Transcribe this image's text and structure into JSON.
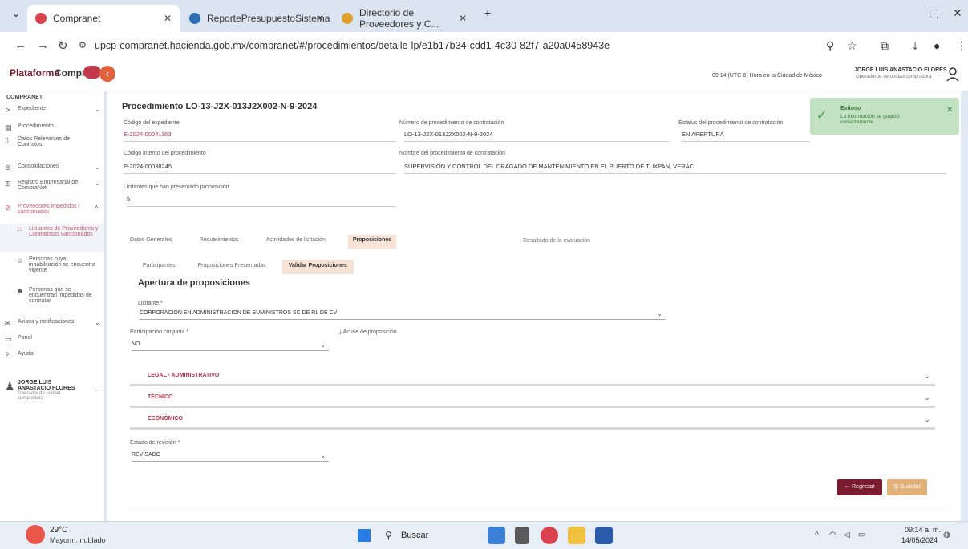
{
  "browser": {
    "tabs": [
      {
        "label": "Compranet"
      },
      {
        "label": "ReportePresupuestoSistema"
      },
      {
        "label": "Directorio de Proveedores y C..."
      }
    ],
    "new_tab": "+",
    "url": "upcp-compranet.hacienda.gob.mx/compranet/#/procedimientos/detalle-lp/e1b17b34-cdd1-4c30-82f7-a20a0458943e"
  },
  "header": {
    "logo_part1": "Plataforma",
    "logo_part2": "Compra",
    "hora": "09:14 (UTC-6) Hora en la Ciudad de México",
    "user_name": "JORGE LUIS ANASTACIO FLORES",
    "user_role": "Operador(a) de unidad compradora"
  },
  "sidebar": {
    "title": "COMPRANET",
    "items": [
      {
        "label": "Expediente",
        "icon": "folder-icon"
      },
      {
        "label": "Procedimiento",
        "icon": "document-icon"
      },
      {
        "label": "Datos Relevantes de Contratos",
        "icon": "bookmark-icon"
      },
      {
        "label": "Consolidaciones",
        "icon": "consolidation-icon"
      },
      {
        "label": "Registro Empresarial de CompraNet",
        "icon": "registry-icon"
      },
      {
        "label": "Proveedores impedidos / sancionados",
        "icon": "warning-icon"
      },
      {
        "label": "Licitantes de Proveedores y Contratistas Sancionados",
        "icon": "sanction-icon"
      },
      {
        "label": "Personas cuya inhabilitación se encuentra vigente",
        "icon": "person-icon"
      },
      {
        "label": "Personas que se encuentran impedidas de contratar",
        "icon": "person-block-icon"
      },
      {
        "label": "Avisos y notificaciones",
        "icon": "mail-icon"
      },
      {
        "label": "Panel",
        "icon": "panel-icon"
      },
      {
        "label": "Ayuda",
        "icon": "help-icon"
      }
    ],
    "user_name": "JORGE LUIS ANASTACIO FLORES",
    "user_role": "Operador de unidad compradora"
  },
  "main": {
    "title": "Procedimiento LO-13-J2X-013J2X002-N-9-2024",
    "codigo_expediente_label": "Código del expediente",
    "codigo_expediente": "E-2024-00041163",
    "numero_proc_label": "Número de procedimiento de contratación",
    "numero_proc": "LO-13-J2X-013J2X002-N-9-2024",
    "estatus_label": "Estatus del procedimiento de contratación",
    "estatus": "EN APERTURA",
    "codigo_interno_label": "Código interno del procedimiento",
    "codigo_interno": "P-2024-00038245",
    "nombre_label": "Nombre del procedimiento de contratación",
    "nombre": "SUPERVISION Y CONTROL DEL DRAGADO DE MANTENIMIENTO EN EL PUERTO DE TUXPAN, VERAC",
    "licitantes_label": "Licitantes que han presentado proposición",
    "licitantes": "5",
    "tabs": [
      "Datos Generales",
      "Requerimientos",
      "Actividades de licitación",
      "Proposiciones"
    ],
    "tab_extra": "Resultado de la evaluación",
    "subtabs": [
      "Participantes",
      "Proposiciones Presentadas",
      "Validar Proposiciones"
    ],
    "section_title": "Apertura de proposiciones",
    "licitante_label": "Licitante *",
    "licitante_value": "CORPORACION EN ADMINISTRACION DE SUMINISTROS SC DE RL DE CV",
    "participacion_label": "Participación conjunta *",
    "participacion_value": "NO",
    "acuse_label": "Acuse de proposición",
    "accordions": [
      "LEGAL - ADMINISTRATIVO",
      "TÉCNICO",
      "ECONÓMICO"
    ],
    "estado_label": "Estado de revisión *",
    "estado_value": "REVISADO",
    "btn_regresar": "Regresar",
    "btn_guardar": "Guardar"
  },
  "toast": {
    "title": "Exitoso",
    "message": "La información se guardó correctamente"
  },
  "taskbar": {
    "temp": "29°C",
    "weather": "Mayorm. nublado",
    "search": "Buscar",
    "time": "09:14 a. m.",
    "date": "14/05/2024"
  },
  "colors": {
    "brand": "#7a1b30",
    "accent": "#e0623d",
    "success": "#c3e2c3",
    "tab_active": "#f6e3d5"
  }
}
